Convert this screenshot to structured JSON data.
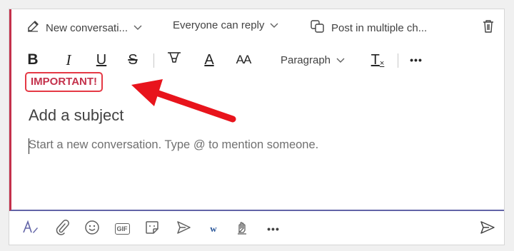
{
  "header": {
    "post_type_label": "New conversati...",
    "reply_setting_label": "Everyone can reply",
    "multi_post_label": "Post in multiple ch..."
  },
  "toolbar": {
    "bold": "B",
    "italic": "I",
    "underline": "U",
    "strike": "S",
    "font_color": "A",
    "font_size": "AA",
    "paragraph_label": "Paragraph",
    "clear_format": "T",
    "more": "•••"
  },
  "compose": {
    "announcement_label": "IMPORTANT!",
    "subject_placeholder": "Add a subject",
    "body_placeholder": "Start a new conversation. Type @ to mention someone."
  },
  "bottom_bar": {
    "gif_label": "GIF",
    "more": "•••"
  },
  "colors": {
    "important_red": "#c4314b",
    "arrow_red": "#e8141c",
    "accent": "#6264a7"
  }
}
